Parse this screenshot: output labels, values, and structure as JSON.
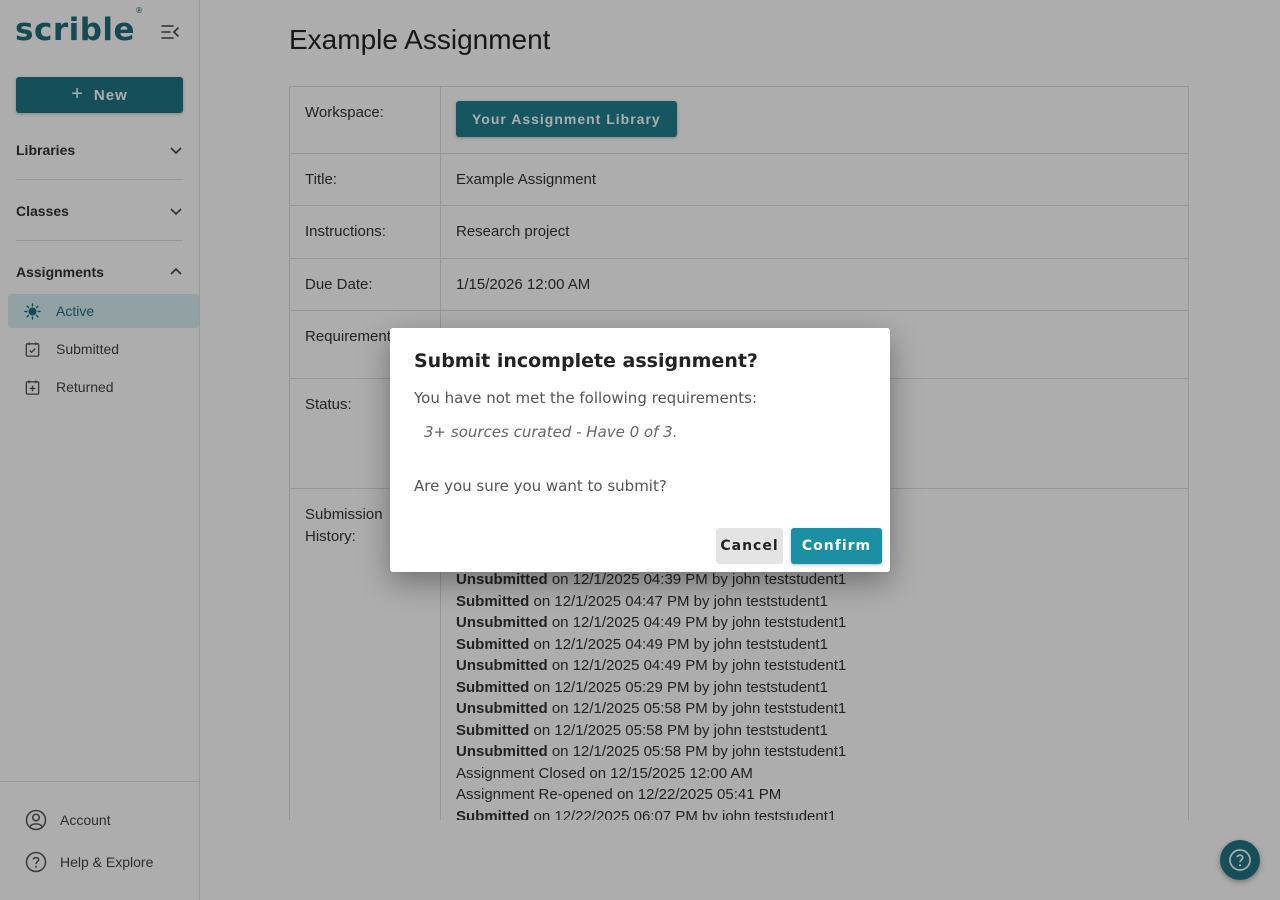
{
  "app": {
    "logo": "scrible",
    "logo_mark": "®"
  },
  "sidebar": {
    "new_label": "New",
    "sections": [
      {
        "label": "Libraries"
      },
      {
        "label": "Classes"
      },
      {
        "label": "Assignments"
      }
    ],
    "assignment_items": [
      {
        "label": "Active",
        "icon": "sun-icon",
        "active": true
      },
      {
        "label": "Submitted",
        "icon": "calendar-check-icon",
        "active": false
      },
      {
        "label": "Returned",
        "icon": "calendar-return-icon",
        "active": false
      }
    ],
    "bottom": [
      {
        "label": "Account",
        "icon": "account-icon"
      },
      {
        "label": "Help & Explore",
        "icon": "help-icon"
      }
    ]
  },
  "main": {
    "title": "Example Assignment",
    "rows": {
      "workspace": {
        "label": "Workspace:",
        "button": "Your Assignment Library"
      },
      "title": {
        "label": "Title:",
        "value": "Example Assignment"
      },
      "instructions": {
        "label": "Instructions:",
        "value": "Research project"
      },
      "due_date": {
        "label": "Due Date:",
        "value": "1/15/2026 12:00 AM"
      },
      "requirements": {
        "label": "Requirements:"
      },
      "status": {
        "label": "Status:"
      },
      "history": {
        "label_line1": "Submission",
        "label_line2": "History:"
      }
    },
    "history": [
      {
        "action": "Unsubmitted",
        "bold": true,
        "on": "on 12/1/2025 04:39 PM",
        "by": "by john teststudent1"
      },
      {
        "action": "Submitted",
        "bold": true,
        "on": "on 12/1/2025 04:47 PM",
        "by": "by john teststudent1"
      },
      {
        "action": "Unsubmitted",
        "bold": true,
        "on": "on 12/1/2025 04:49 PM",
        "by": "by john teststudent1"
      },
      {
        "action": "Submitted",
        "bold": true,
        "on": "on 12/1/2025 04:49 PM",
        "by": "by john teststudent1"
      },
      {
        "action": "Unsubmitted",
        "bold": true,
        "on": "on 12/1/2025 04:49 PM",
        "by": "by john teststudent1"
      },
      {
        "action": "Submitted",
        "bold": true,
        "on": "on 12/1/2025 05:29 PM",
        "by": "by john teststudent1"
      },
      {
        "action": "Unsubmitted",
        "bold": true,
        "on": "on 12/1/2025 05:58 PM",
        "by": "by john teststudent1"
      },
      {
        "action": "Submitted",
        "bold": true,
        "on": "on 12/1/2025 05:58 PM",
        "by": "by john teststudent1"
      },
      {
        "action": "Unsubmitted",
        "bold": true,
        "on": "on 12/1/2025 05:58 PM",
        "by": "by john teststudent1"
      },
      {
        "action": "Assignment Closed",
        "bold": false,
        "on": "on 12/15/2025 12:00 AM",
        "by": ""
      },
      {
        "action": "Assignment Re-opened",
        "bold": false,
        "on": "on 12/22/2025 05:41 PM",
        "by": ""
      },
      {
        "action": "Submitted",
        "bold": true,
        "on": "on 12/22/2025 06:07 PM",
        "by": "by john teststudent1"
      }
    ]
  },
  "dialog": {
    "title": "Submit incomplete assignment?",
    "message": "You have not met the following requirements:",
    "requirement": "3+ sources curated - Have 0 of 3.",
    "question": "Are you sure you want to submit?",
    "cancel_label": "Cancel",
    "confirm_label": "Confirm"
  },
  "colors": {
    "brand": "#1f7585",
    "confirm": "#1b8fa3",
    "active_bg": "#d8eef0"
  }
}
